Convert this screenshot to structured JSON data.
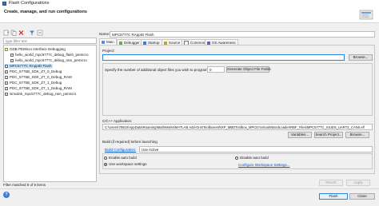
{
  "window": {
    "title": "Flash Configurations"
  },
  "header": {
    "title": "Create, manage, and run configurations"
  },
  "toolbar": {
    "icons": [
      "new-config-icon",
      "duplicate-icon",
      "delete-icon",
      "filter-icon",
      "collapse-icon"
    ]
  },
  "filter": {
    "placeholder": "type filter text",
    "status": "Filter matched 9 of 9 items"
  },
  "tree": [
    {
      "label": "GDB PEMicro Interface Debugging",
      "indent": 0,
      "type": "group",
      "selected": false
    },
    {
      "label": "hello_world_mpc5777c_debug_flash_pemicro",
      "indent": 1,
      "type": "item",
      "selected": false
    },
    {
      "label": "hello_world_mpc5777c_debug_ram_pemicro",
      "indent": 1,
      "type": "item",
      "selected": false
    },
    {
      "label": "MPC5777C RAppID Flash",
      "indent": 0,
      "type": "item",
      "selected": true
    },
    {
      "label": "PDC_5775B_SDK_Z7_0_Debug",
      "indent": 0,
      "type": "item",
      "selected": false
    },
    {
      "label": "PDC_5775B_SDK_Z7_0_Debug_RAM",
      "indent": 0,
      "type": "item",
      "selected": false
    },
    {
      "label": "PDC_5775B_SDK_Z7_1_Debug",
      "indent": 0,
      "type": "item",
      "selected": false
    },
    {
      "label": "PDC_5775B_SDK_Z7_1_Debug_RAM",
      "indent": 0,
      "type": "item",
      "selected": false
    },
    {
      "label": "simulink_mpc5777c_debug_ram_pemicro",
      "indent": 0,
      "type": "item",
      "selected": false
    }
  ],
  "name_field": {
    "label": "Name:",
    "value": "MPC5777C RAppID Flash"
  },
  "tabs": [
    {
      "label": "Main",
      "icon": "main-tab-icon",
      "active": true
    },
    {
      "label": "Debugger",
      "icon": "debugger-tab-icon",
      "active": false
    },
    {
      "label": "Startup",
      "icon": "startup-tab-icon",
      "active": false
    },
    {
      "label": "Source",
      "icon": "source-tab-icon",
      "active": false
    },
    {
      "label": "Common",
      "icon": "common-tab-icon",
      "active": false
    },
    {
      "label": "OS Awareness",
      "icon": "os-awareness-tab-icon",
      "active": false
    }
  ],
  "main": {
    "project_label": "Project:",
    "project_value": "",
    "browse1": "Browse...",
    "objects_label": "Specify the number of additional object files you wish to program:",
    "objects_value": "0",
    "generate_button": "Generate Object File Fields",
    "app_label": "C/C++ Application:",
    "app_value": "C:\\Users\\75810\\AppData\\Roaming\\MathWorks\\MATLAB Add-Ons\\Toolboxes\\NXP_MBDToolbox_MPC57xx\\tools\\BootLoader\\RBF_Files\\MPC5777C_SIUDS_UART2_CAN0.elf",
    "variables_button": "Variables...",
    "search_project_button": "Search Project...",
    "browse2": "Browse...",
    "build_before_label": "Build (if required) before launching",
    "build_config_link": "Build Configuration:",
    "build_config_value": "Use Active",
    "enable_auto_build": "Enable auto build",
    "disable_auto_build": "Disable auto build",
    "use_workspace_settings": "Use workspace settings",
    "configure_workspace_link": "Configure Workspace Settings...",
    "auto_build_selection": "use_workspace_settings"
  },
  "footer": {
    "revert": "Revert",
    "apply": "Apply",
    "flash": "Flash",
    "close": "Close"
  },
  "colors": {
    "selection": "#cce8ff",
    "link": "#0055cc",
    "accent": "#2b84d6"
  }
}
